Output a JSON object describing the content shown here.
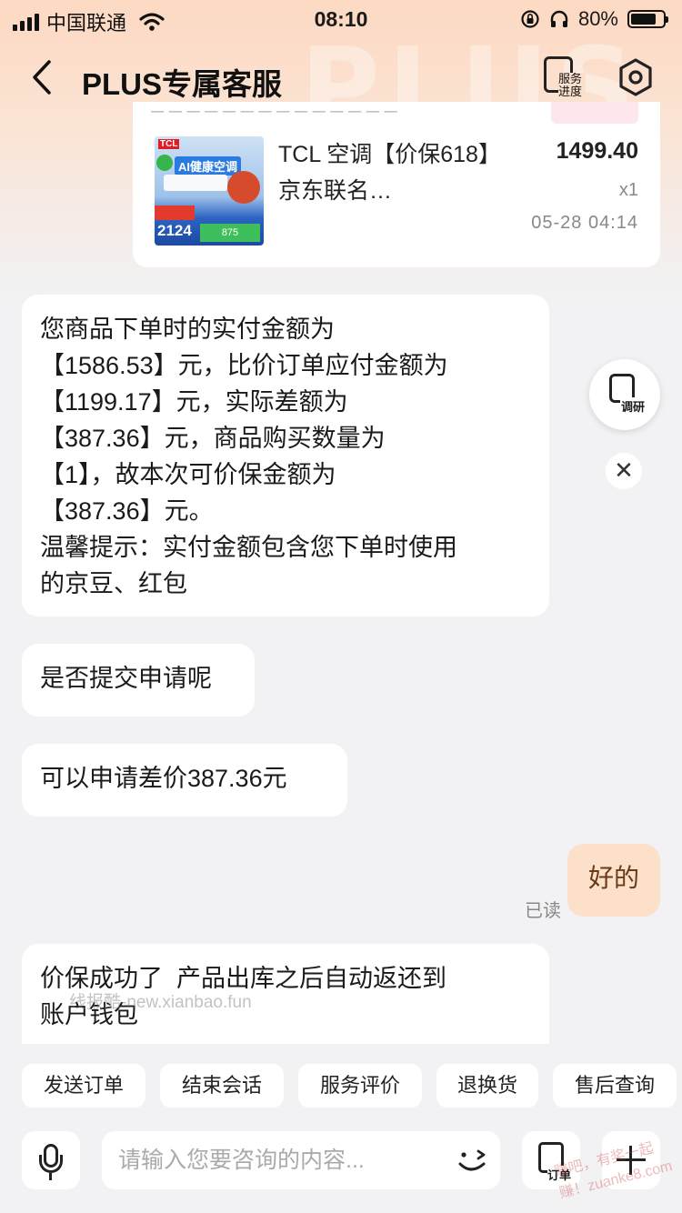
{
  "status_bar": {
    "carrier": "中国联通",
    "time": "08:10",
    "battery": "80%",
    "battery_level": 0.8
  },
  "nav": {
    "title": "PLUS专属客服",
    "service_progress_label": "服务\n进度",
    "bg_watermark": "PLUS"
  },
  "product_card": {
    "title": "TCL 空调【价保618】京东联名…",
    "price": "1499.40",
    "quantity": "x1",
    "time": "05-28 04:14",
    "thumb": {
      "brand": "TCL",
      "headline": "AI健康空调",
      "price": "2124",
      "strip": "875"
    }
  },
  "messages": [
    {
      "side": "left",
      "text": "您商品下单时的实付金额为\n【1586.53】元，比价订单应付金额为\n【1199.17】元，实际差额为\n【387.36】元，商品购买数量为\n【1】，故本次可价保金额为\n【387.36】元。\n温馨提示：实付金额包含您下单时使用\n的京豆、红包"
    },
    {
      "side": "left",
      "text": "是否提交申请呢"
    },
    {
      "side": "left",
      "text": "可以申请差价387.36元"
    },
    {
      "side": "right",
      "text": "好的",
      "status": "已读"
    },
    {
      "side": "left",
      "text": "价保成功了  产品出库之后自动返还到\n账户钱包"
    }
  ],
  "watermark": "线报酷-new.xianbao.fun",
  "floating": {
    "survey_label": "调研",
    "close_symbol": "✕"
  },
  "quick_actions": [
    "发送订单",
    "结束会话",
    "服务评价",
    "退换货",
    "售后查询"
  ],
  "input": {
    "placeholder": "请输入您要咨询的内容...",
    "order_label": "订单"
  },
  "corner_watermark": "赚吧，有奖一起赚！zuanke8.com"
}
